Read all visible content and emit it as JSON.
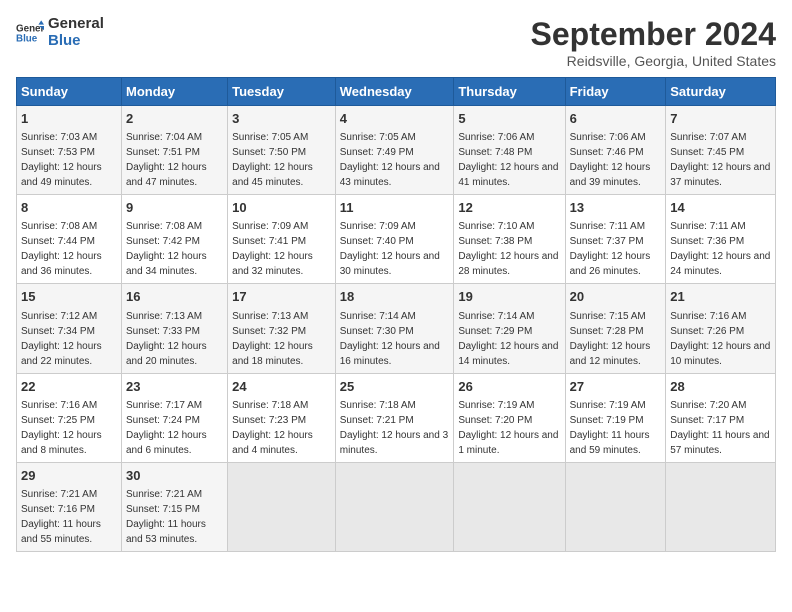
{
  "logo": {
    "line1": "General",
    "line2": "Blue"
  },
  "title": "September 2024",
  "subtitle": "Reidsville, Georgia, United States",
  "days_of_week": [
    "Sunday",
    "Monday",
    "Tuesday",
    "Wednesday",
    "Thursday",
    "Friday",
    "Saturday"
  ],
  "weeks": [
    [
      {
        "day": "1",
        "sunrise": "Sunrise: 7:03 AM",
        "sunset": "Sunset: 7:53 PM",
        "daylight": "Daylight: 12 hours and 49 minutes."
      },
      {
        "day": "2",
        "sunrise": "Sunrise: 7:04 AM",
        "sunset": "Sunset: 7:51 PM",
        "daylight": "Daylight: 12 hours and 47 minutes."
      },
      {
        "day": "3",
        "sunrise": "Sunrise: 7:05 AM",
        "sunset": "Sunset: 7:50 PM",
        "daylight": "Daylight: 12 hours and 45 minutes."
      },
      {
        "day": "4",
        "sunrise": "Sunrise: 7:05 AM",
        "sunset": "Sunset: 7:49 PM",
        "daylight": "Daylight: 12 hours and 43 minutes."
      },
      {
        "day": "5",
        "sunrise": "Sunrise: 7:06 AM",
        "sunset": "Sunset: 7:48 PM",
        "daylight": "Daylight: 12 hours and 41 minutes."
      },
      {
        "day": "6",
        "sunrise": "Sunrise: 7:06 AM",
        "sunset": "Sunset: 7:46 PM",
        "daylight": "Daylight: 12 hours and 39 minutes."
      },
      {
        "day": "7",
        "sunrise": "Sunrise: 7:07 AM",
        "sunset": "Sunset: 7:45 PM",
        "daylight": "Daylight: 12 hours and 37 minutes."
      }
    ],
    [
      {
        "day": "8",
        "sunrise": "Sunrise: 7:08 AM",
        "sunset": "Sunset: 7:44 PM",
        "daylight": "Daylight: 12 hours and 36 minutes."
      },
      {
        "day": "9",
        "sunrise": "Sunrise: 7:08 AM",
        "sunset": "Sunset: 7:42 PM",
        "daylight": "Daylight: 12 hours and 34 minutes."
      },
      {
        "day": "10",
        "sunrise": "Sunrise: 7:09 AM",
        "sunset": "Sunset: 7:41 PM",
        "daylight": "Daylight: 12 hours and 32 minutes."
      },
      {
        "day": "11",
        "sunrise": "Sunrise: 7:09 AM",
        "sunset": "Sunset: 7:40 PM",
        "daylight": "Daylight: 12 hours and 30 minutes."
      },
      {
        "day": "12",
        "sunrise": "Sunrise: 7:10 AM",
        "sunset": "Sunset: 7:38 PM",
        "daylight": "Daylight: 12 hours and 28 minutes."
      },
      {
        "day": "13",
        "sunrise": "Sunrise: 7:11 AM",
        "sunset": "Sunset: 7:37 PM",
        "daylight": "Daylight: 12 hours and 26 minutes."
      },
      {
        "day": "14",
        "sunrise": "Sunrise: 7:11 AM",
        "sunset": "Sunset: 7:36 PM",
        "daylight": "Daylight: 12 hours and 24 minutes."
      }
    ],
    [
      {
        "day": "15",
        "sunrise": "Sunrise: 7:12 AM",
        "sunset": "Sunset: 7:34 PM",
        "daylight": "Daylight: 12 hours and 22 minutes."
      },
      {
        "day": "16",
        "sunrise": "Sunrise: 7:13 AM",
        "sunset": "Sunset: 7:33 PM",
        "daylight": "Daylight: 12 hours and 20 minutes."
      },
      {
        "day": "17",
        "sunrise": "Sunrise: 7:13 AM",
        "sunset": "Sunset: 7:32 PM",
        "daylight": "Daylight: 12 hours and 18 minutes."
      },
      {
        "day": "18",
        "sunrise": "Sunrise: 7:14 AM",
        "sunset": "Sunset: 7:30 PM",
        "daylight": "Daylight: 12 hours and 16 minutes."
      },
      {
        "day": "19",
        "sunrise": "Sunrise: 7:14 AM",
        "sunset": "Sunset: 7:29 PM",
        "daylight": "Daylight: 12 hours and 14 minutes."
      },
      {
        "day": "20",
        "sunrise": "Sunrise: 7:15 AM",
        "sunset": "Sunset: 7:28 PM",
        "daylight": "Daylight: 12 hours and 12 minutes."
      },
      {
        "day": "21",
        "sunrise": "Sunrise: 7:16 AM",
        "sunset": "Sunset: 7:26 PM",
        "daylight": "Daylight: 12 hours and 10 minutes."
      }
    ],
    [
      {
        "day": "22",
        "sunrise": "Sunrise: 7:16 AM",
        "sunset": "Sunset: 7:25 PM",
        "daylight": "Daylight: 12 hours and 8 minutes."
      },
      {
        "day": "23",
        "sunrise": "Sunrise: 7:17 AM",
        "sunset": "Sunset: 7:24 PM",
        "daylight": "Daylight: 12 hours and 6 minutes."
      },
      {
        "day": "24",
        "sunrise": "Sunrise: 7:18 AM",
        "sunset": "Sunset: 7:23 PM",
        "daylight": "Daylight: 12 hours and 4 minutes."
      },
      {
        "day": "25",
        "sunrise": "Sunrise: 7:18 AM",
        "sunset": "Sunset: 7:21 PM",
        "daylight": "Daylight: 12 hours and 3 minutes."
      },
      {
        "day": "26",
        "sunrise": "Sunrise: 7:19 AM",
        "sunset": "Sunset: 7:20 PM",
        "daylight": "Daylight: 12 hours and 1 minute."
      },
      {
        "day": "27",
        "sunrise": "Sunrise: 7:19 AM",
        "sunset": "Sunset: 7:19 PM",
        "daylight": "Daylight: 11 hours and 59 minutes."
      },
      {
        "day": "28",
        "sunrise": "Sunrise: 7:20 AM",
        "sunset": "Sunset: 7:17 PM",
        "daylight": "Daylight: 11 hours and 57 minutes."
      }
    ],
    [
      {
        "day": "29",
        "sunrise": "Sunrise: 7:21 AM",
        "sunset": "Sunset: 7:16 PM",
        "daylight": "Daylight: 11 hours and 55 minutes."
      },
      {
        "day": "30",
        "sunrise": "Sunrise: 7:21 AM",
        "sunset": "Sunset: 7:15 PM",
        "daylight": "Daylight: 11 hours and 53 minutes."
      },
      null,
      null,
      null,
      null,
      null
    ]
  ]
}
